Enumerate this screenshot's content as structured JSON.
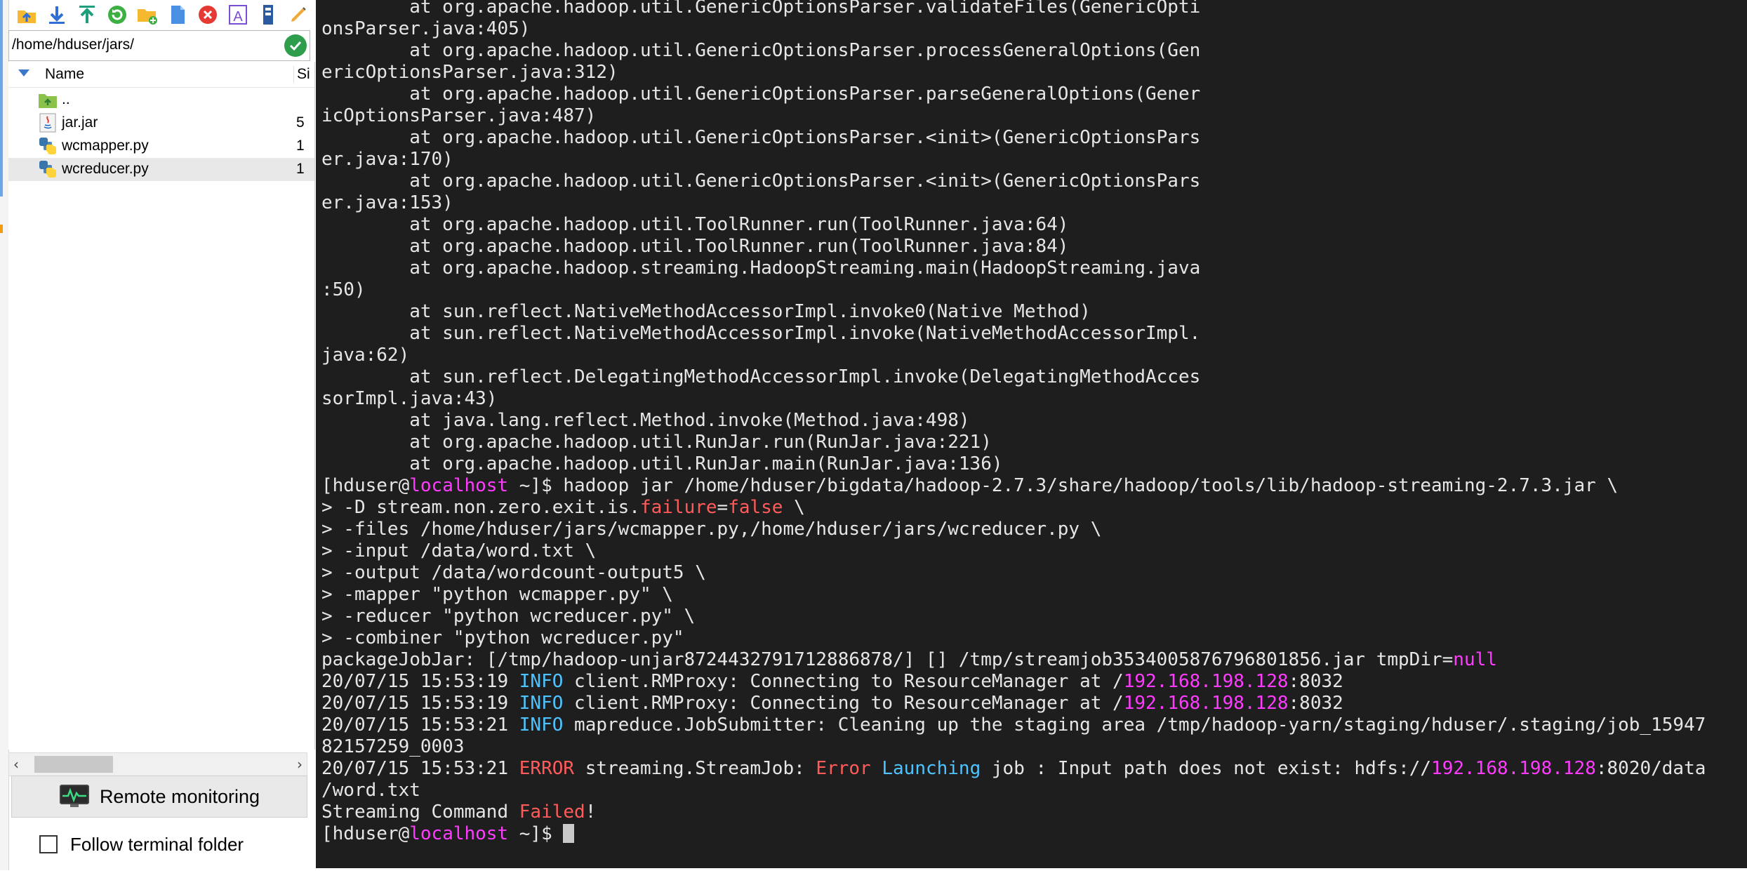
{
  "file_browser": {
    "path": "/home/hduser/jars/",
    "columns": {
      "name": "Name",
      "size": "Si"
    },
    "files": [
      {
        "name": "..",
        "size": "",
        "icon": "parent-folder-icon"
      },
      {
        "name": "jar.jar",
        "size": "5",
        "icon": "java-file-icon"
      },
      {
        "name": "wcmapper.py",
        "size": "1",
        "icon": "python-file-icon"
      },
      {
        "name": "wcreducer.py",
        "size": "1",
        "icon": "python-file-icon",
        "selected": true
      }
    ],
    "toolbar_icons": [
      "parent-directory-icon",
      "download-icon",
      "upload-icon",
      "refresh-icon",
      "new-folder-icon",
      "new-file-icon",
      "delete-icon",
      "rename-icon",
      "permissions-icon",
      "edit-icon"
    ],
    "remote_monitoring_label": "Remote monitoring",
    "follow_terminal_label": "Follow terminal folder",
    "follow_terminal_checked": false
  },
  "terminal": {
    "lines": [
      [
        {
          "t": "        at org.apache.hadoop.util.GenericOptionsParser.validateFiles(GenericOpti"
        }
      ],
      [
        {
          "t": "onsParser.java:405)"
        }
      ],
      [
        {
          "t": "        at org.apache.hadoop.util.GenericOptionsParser.processGeneralOptions(Gen"
        }
      ],
      [
        {
          "t": "ericOptionsParser.java:312)"
        }
      ],
      [
        {
          "t": "        at org.apache.hadoop.util.GenericOptionsParser.parseGeneralOptions(Gener"
        }
      ],
      [
        {
          "t": "icOptionsParser.java:487)"
        }
      ],
      [
        {
          "t": "        at org.apache.hadoop.util.GenericOptionsParser.<init>(GenericOptionsPars"
        }
      ],
      [
        {
          "t": "er.java:170)"
        }
      ],
      [
        {
          "t": "        at org.apache.hadoop.util.GenericOptionsParser.<init>(GenericOptionsPars"
        }
      ],
      [
        {
          "t": "er.java:153)"
        }
      ],
      [
        {
          "t": "        at org.apache.hadoop.util.ToolRunner.run(ToolRunner.java:64)"
        }
      ],
      [
        {
          "t": "        at org.apache.hadoop.util.ToolRunner.run(ToolRunner.java:84)"
        }
      ],
      [
        {
          "t": "        at org.apache.hadoop.streaming.HadoopStreaming.main(HadoopStreaming.java"
        }
      ],
      [
        {
          "t": ":50)"
        }
      ],
      [
        {
          "t": "        at sun.reflect.NativeMethodAccessorImpl.invoke0(Native Method)"
        }
      ],
      [
        {
          "t": "        at sun.reflect.NativeMethodAccessorImpl.invoke(NativeMethodAccessorImpl."
        }
      ],
      [
        {
          "t": "java:62)"
        }
      ],
      [
        {
          "t": "        at sun.reflect.DelegatingMethodAccessorImpl.invoke(DelegatingMethodAcces"
        }
      ],
      [
        {
          "t": "sorImpl.java:43)"
        }
      ],
      [
        {
          "t": "        at java.lang.reflect.Method.invoke(Method.java:498)"
        }
      ],
      [
        {
          "t": "        at org.apache.hadoop.util.RunJar.run(RunJar.java:221)"
        }
      ],
      [
        {
          "t": "        at org.apache.hadoop.util.RunJar.main(RunJar.java:136)"
        }
      ],
      [
        {
          "t": "[hduser@"
        },
        {
          "t": "localhost",
          "c": "mag"
        },
        {
          "t": " ~]$ hadoop jar /home/hduser/bigdata/hadoop-2.7.3/share/hadoop/tools/lib/hadoop-streaming-2.7.3.jar \\"
        }
      ],
      [
        {
          "t": "> -D stream.non.zero.exit.is."
        },
        {
          "t": "failure",
          "c": "red"
        },
        {
          "t": "="
        },
        {
          "t": "false",
          "c": "red"
        },
        {
          "t": " \\"
        }
      ],
      [
        {
          "t": "> -files /home/hduser/jars/wcmapper.py,/home/hduser/jars/wcreducer.py \\"
        }
      ],
      [
        {
          "t": "> -input /data/word.txt \\"
        }
      ],
      [
        {
          "t": "> -output /data/wordcount-output5 \\"
        }
      ],
      [
        {
          "t": "> -mapper \"python wcmapper.py\" \\"
        }
      ],
      [
        {
          "t": "> -reducer \"python wcreducer.py\" \\"
        }
      ],
      [
        {
          "t": "> -combiner \"python wcreducer.py\""
        }
      ],
      [
        {
          "t": "packageJobJar: [/tmp/hadoop-unjar8724432791712886878/] [] /tmp/streamjob3534005876796801856.jar tmpDir="
        },
        {
          "t": "null",
          "c": "mag"
        }
      ],
      [
        {
          "t": "20/07/15 15:53:19 "
        },
        {
          "t": "INFO",
          "c": "blue"
        },
        {
          "t": " client.RMProxy: Connecting to ResourceManager at /"
        },
        {
          "t": "192.168.198.128",
          "c": "mag"
        },
        {
          "t": ":8032"
        }
      ],
      [
        {
          "t": "20/07/15 15:53:19 "
        },
        {
          "t": "INFO",
          "c": "blue"
        },
        {
          "t": " client.RMProxy: Connecting to ResourceManager at /"
        },
        {
          "t": "192.168.198.128",
          "c": "mag"
        },
        {
          "t": ":8032"
        }
      ],
      [
        {
          "t": "20/07/15 15:53:21 "
        },
        {
          "t": "INFO",
          "c": "blue"
        },
        {
          "t": " mapreduce.JobSubmitter: Cleaning up the staging area /tmp/hadoop-yarn/staging/hduser/.staging/job_15947"
        }
      ],
      [
        {
          "t": "82157259_0003"
        }
      ],
      [
        {
          "t": "20/07/15 15:53:21 "
        },
        {
          "t": "ERROR",
          "c": "red"
        },
        {
          "t": " streaming.StreamJob: "
        },
        {
          "t": "Error",
          "c": "red"
        },
        {
          "t": " "
        },
        {
          "t": "Launching",
          "c": "blue"
        },
        {
          "t": " job : Input path does not exist: hdfs://"
        },
        {
          "t": "192.168.198.128",
          "c": "mag"
        },
        {
          "t": ":8020/data"
        }
      ],
      [
        {
          "t": "/word.txt"
        }
      ],
      [
        {
          "t": "Streaming Command "
        },
        {
          "t": "Failed",
          "c": "red"
        },
        {
          "t": "!"
        }
      ],
      [
        {
          "t": "[hduser@"
        },
        {
          "t": "localhost",
          "c": "mag"
        },
        {
          "t": " ~]$ "
        }
      ]
    ]
  },
  "colors": {
    "terminal_bg": "#1e1e1e",
    "terminal_fg": "#e6e6e6",
    "highlight_magenta": "#ff3bff",
    "highlight_blue": "#4fc3ff",
    "highlight_red": "#ff5b5b"
  }
}
